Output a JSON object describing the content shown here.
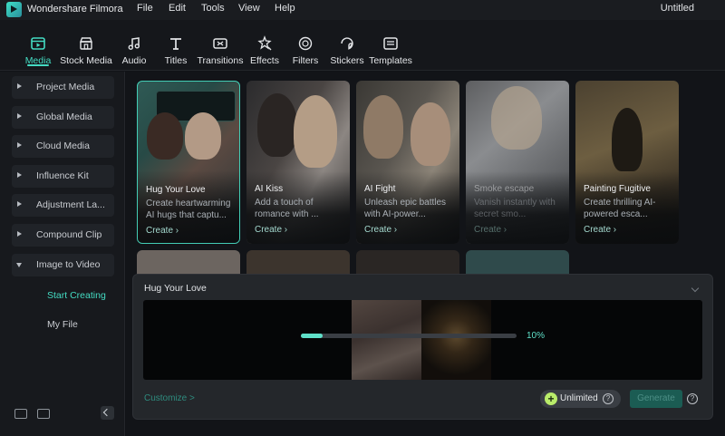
{
  "app": {
    "name": "Wondershare Filmora",
    "document_title": "Untitled",
    "menu": [
      "File",
      "Edit",
      "Tools",
      "View",
      "Help"
    ]
  },
  "toolbar": {
    "tools": [
      {
        "label": "Media",
        "icon": "media-icon",
        "active": true
      },
      {
        "label": "Stock Media",
        "icon": "stock-media-icon"
      },
      {
        "label": "Audio",
        "icon": "music-note-icon"
      },
      {
        "label": "Titles",
        "icon": "titles-icon"
      },
      {
        "label": "Transitions",
        "icon": "transitions-icon"
      },
      {
        "label": "Effects",
        "icon": "effects-icon"
      },
      {
        "label": "Filters",
        "icon": "filters-icon"
      },
      {
        "label": "Stickers",
        "icon": "stickers-icon"
      },
      {
        "label": "Templates",
        "icon": "templates-icon"
      }
    ]
  },
  "sidebar": {
    "items": [
      {
        "label": "Project Media"
      },
      {
        "label": "Global Media"
      },
      {
        "label": "Cloud Media"
      },
      {
        "label": "Influence Kit"
      },
      {
        "label": "Adjustment La..."
      },
      {
        "label": "Compound Clip"
      },
      {
        "label": "Image to Video",
        "expanded": true
      }
    ],
    "subitems": [
      {
        "label": "Start Creating",
        "active": true
      },
      {
        "label": "My File"
      }
    ]
  },
  "cards": [
    {
      "title": "Hug Your Love",
      "desc": "Create heartwarming AI hugs that captu...",
      "cta": "Create",
      "selected": true
    },
    {
      "title": "AI Kiss",
      "desc": "Add a touch of romance with ...",
      "cta": "Create"
    },
    {
      "title": "AI Fight",
      "desc": "Unleash epic battles with AI-power...",
      "cta": "Create"
    },
    {
      "title": "Smoke escape",
      "desc": "Vanish instantly with secret smo...",
      "cta": "Create",
      "dim": true
    },
    {
      "title": "Painting Fugitive",
      "desc": "Create thrilling AI-powered esca...",
      "cta": "Create"
    }
  ],
  "panel": {
    "title": "Hug Your Love",
    "progress_label": "10%",
    "progress_value": 0.1,
    "customize_label": "Customize >",
    "unlimited_label": "Unlimited",
    "generate_label": "Generate"
  },
  "colors": {
    "accent": "#44dcc3",
    "background": "#121418",
    "panel": "#24272b"
  }
}
